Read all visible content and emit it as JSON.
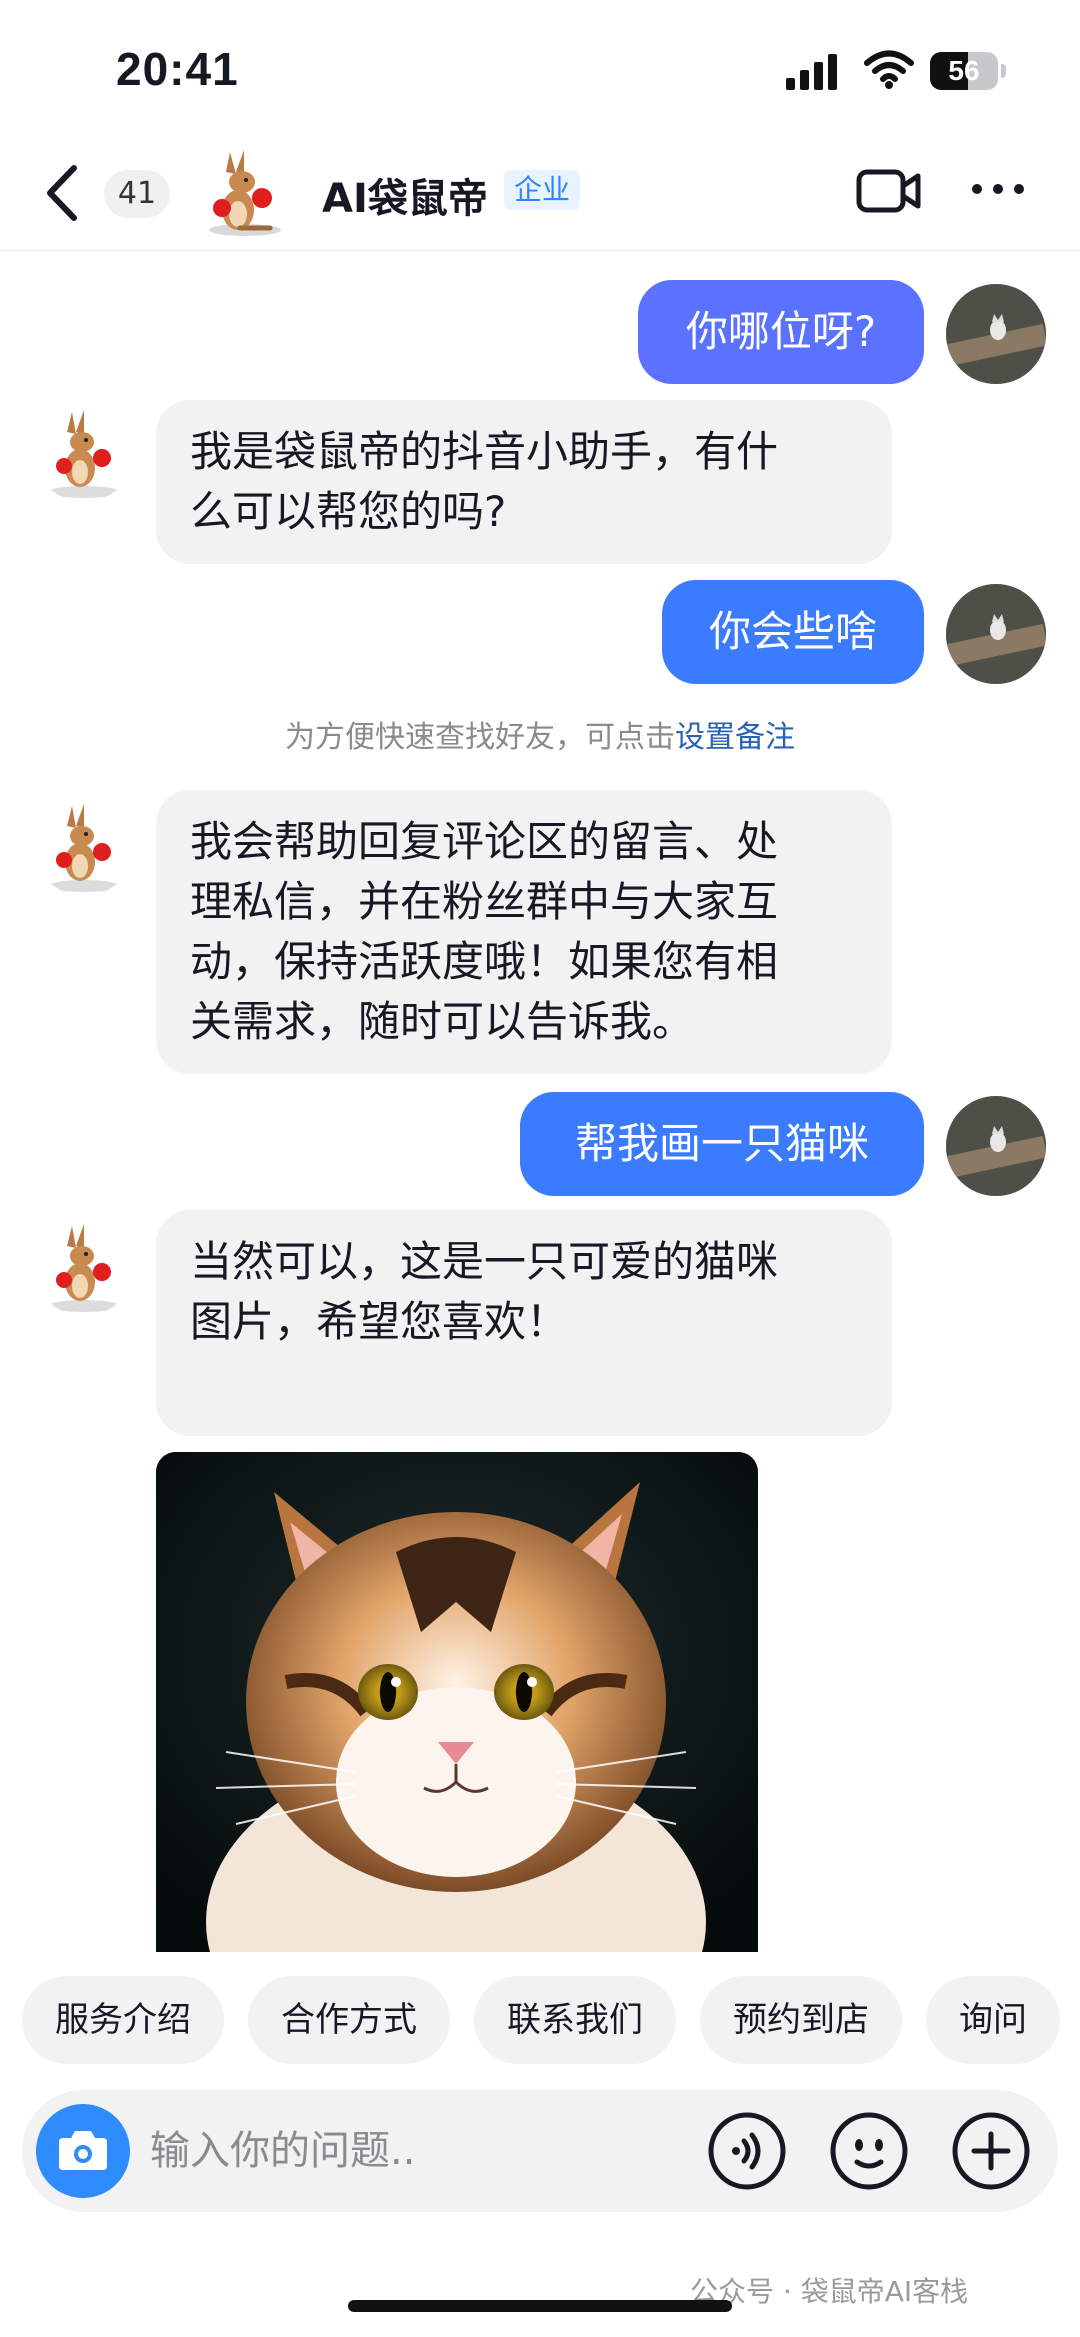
{
  "status_bar": {
    "time": "20:41",
    "battery": "56",
    "battery_level": 0.56
  },
  "header": {
    "unread_count": "41",
    "title": "AI袋鼠帝",
    "tag": "企业",
    "icons": [
      "back-icon",
      "video-call-icon",
      "more-icon"
    ]
  },
  "messages": [
    {
      "side": "out",
      "text": "你哪位呀?"
    },
    {
      "side": "in",
      "lines": [
        "我是袋鼠帝的抖音小助手，有什",
        "么可以帮您的吗?"
      ]
    },
    {
      "side": "out",
      "text": "你会些啥"
    },
    {
      "side": "in",
      "lines": [
        "我会帮助回复评论区的留言、处",
        "理私信，并在粉丝群中与大家互",
        "动，保持活跃度哦！如果您有相",
        "关需求，随时可以告诉我。"
      ]
    },
    {
      "side": "out",
      "text": "帮我画一只猫咪"
    },
    {
      "side": "in",
      "lines": [
        "当然可以，这是一只可爱的猫咪",
        "图片，希望您喜欢！"
      ]
    }
  ],
  "hint": {
    "text": "为方便快速查找好友，可点击",
    "link": "设置备注"
  },
  "quick_replies": [
    "服务介绍",
    "合作方式",
    "联系我们",
    "预约到店",
    "询问"
  ],
  "input": {
    "placeholder": "输入你的问题.."
  },
  "watermark": "公众号 · 袋鼠帝AI客栈",
  "colors": {
    "outgoing_bubble": "#3a7bff",
    "incoming_bubble": "#f2f2f2",
    "camera_button": "#2f8cff",
    "link": "#2961b5"
  }
}
